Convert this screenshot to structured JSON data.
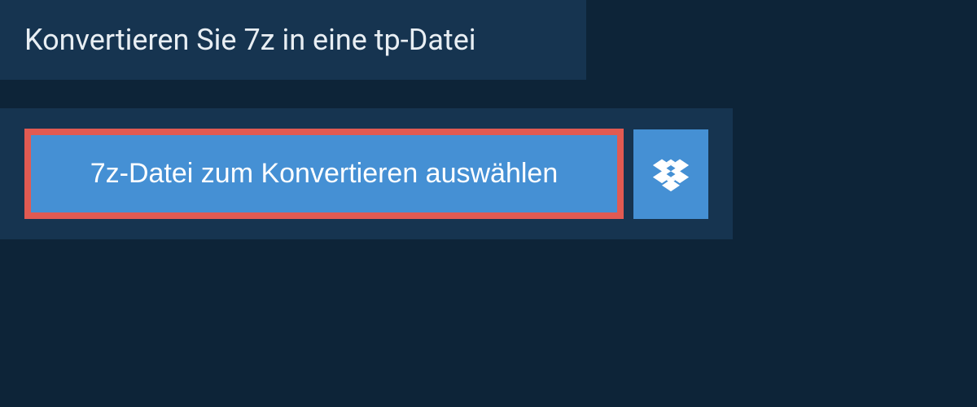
{
  "header": {
    "title": "Konvertieren Sie 7z in eine tp-Datei"
  },
  "upload": {
    "select_button_label": "7z-Datei zum Konvertieren auswählen",
    "dropbox_icon": "dropbox-icon"
  },
  "colors": {
    "background": "#0d2438",
    "panel": "#163450",
    "button": "#4590d4",
    "highlight": "#e15a52"
  }
}
